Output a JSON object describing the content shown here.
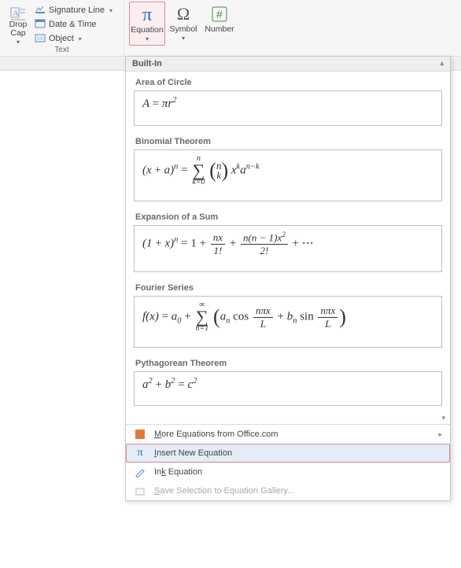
{
  "ribbon": {
    "dropcap_label": "Drop\nCap",
    "sig_line": "Signature Line",
    "date_time": "Date & Time",
    "object": "Object",
    "text_group": "Text",
    "equation_label": "Equation",
    "symbol_label": "Symbol",
    "number_label": "Number"
  },
  "gallery": {
    "header": "Built-In",
    "items": [
      {
        "title": "Area of Circle"
      },
      {
        "title": "Binomial Theorem"
      },
      {
        "title": "Expansion of a Sum"
      },
      {
        "title": "Fourier Series"
      },
      {
        "title": "Pythagorean Theorem"
      }
    ]
  },
  "menu": {
    "more": "More Equations from Office.com",
    "insert_new": "Insert New Equation",
    "ink": "Ink Equation",
    "save_sel": "Save Selection to Equation Gallery..."
  },
  "chart_data": [
    {
      "type": "table",
      "title": "Area of Circle",
      "formula": "A = π r^2"
    },
    {
      "type": "table",
      "title": "Binomial Theorem",
      "formula": "(x + a)^n = Σ_{k=0}^{n} C(n,k) x^k a^{n-k}"
    },
    {
      "type": "table",
      "title": "Expansion of a Sum",
      "formula": "(1 + x)^n = 1 + n x / 1! + n(n-1) x^2 / 2! + ..."
    },
    {
      "type": "table",
      "title": "Fourier Series",
      "formula": "f(x) = a_0 + Σ_{n=1}^{∞} ( a_n cos(nπx/L) + b_n sin(nπx/L) )"
    },
    {
      "type": "table",
      "title": "Pythagorean Theorem",
      "formula": "a^2 + b^2 = c^2"
    }
  ]
}
